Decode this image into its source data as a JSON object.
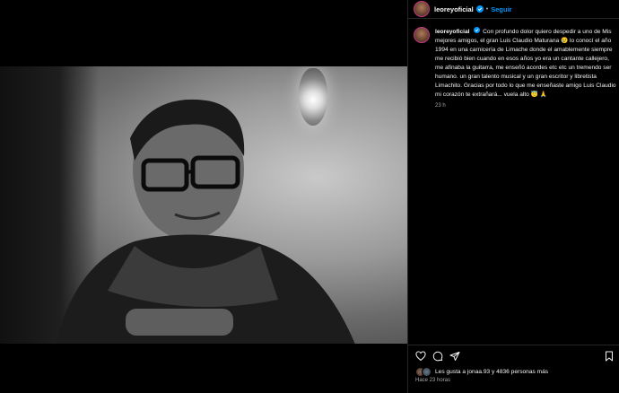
{
  "post": {
    "username": "leoreyoficial",
    "follow_label": "Seguir",
    "caption_username": "leoreyoficial",
    "caption_text": "Con profundo dolor quiero despedir a uno de Mis mejores amigos, el gran Luis Claudio Maturana 😢 lo conocí el año 1994 en una carnicería de Limache donde el amablemente siempre me recibió bien cuando en esos años yo era un cantante callejero, me afinaba la guitarra, me enseñó acordes etc etc un tremendo ser humano. un gran talento musical y un gran escritor y libretista Limachito. Gracias por todo lo que me enseñaste amigo Luis Claudio mi corazón te extrañará... vuela alto 😇 🙏",
    "caption_time": "23 h",
    "likes_text": "Les gusta a jonaa.93 y 4836 personas más",
    "posted_ago": "Hace 23 horas"
  },
  "icons": [
    "verified-badge-icon",
    "heart-icon",
    "comment-icon",
    "share-icon",
    "bookmark-icon"
  ],
  "colors": {
    "accent": "#0095f6",
    "background": "#000000",
    "muted": "#a8a8a8"
  }
}
